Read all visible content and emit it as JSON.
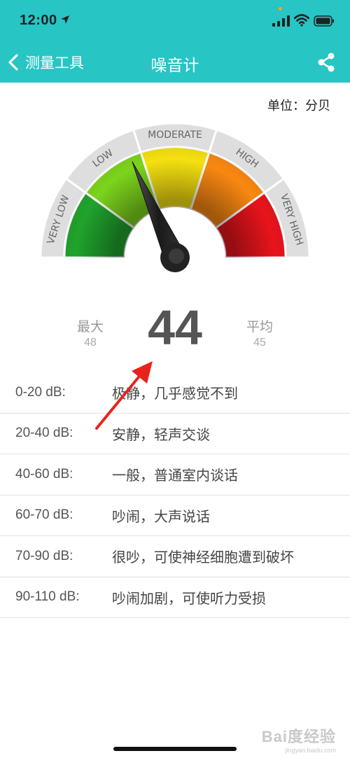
{
  "status_bar": {
    "time": "12:00"
  },
  "nav": {
    "back_label": "测量工具",
    "title": "噪音计"
  },
  "unit_label": "单位：分贝",
  "gauge": {
    "segments": [
      "VERY LOW",
      "LOW",
      "MODERATE",
      "HIGH",
      "VERY HIGH"
    ],
    "colors": [
      "#20a32c",
      "#7cd41c",
      "#f5e010",
      "#f98812",
      "#e8141c"
    ],
    "needle_value": 44,
    "max_value": 120
  },
  "readings": {
    "max_label": "最大",
    "max_value": "48",
    "current": "44",
    "avg_label": "平均",
    "avg_value": "45"
  },
  "levels": [
    {
      "range": "0-20 dB:",
      "desc": "极静，几乎感觉不到"
    },
    {
      "range": "20-40 dB:",
      "desc": "安静，轻声交谈"
    },
    {
      "range": "40-60 dB:",
      "desc": "一般，普通室内谈话"
    },
    {
      "range": "60-70 dB:",
      "desc": "吵闹，大声说话"
    },
    {
      "range": "70-90 dB:",
      "desc": "很吵，可使神经细胞遭到破坏"
    },
    {
      "range": "90-110 dB:",
      "desc": "吵闹加剧，可使听力受损"
    }
  ],
  "watermark": {
    "logo": "Bai度经验",
    "url": "jingyan.baidu.com"
  }
}
